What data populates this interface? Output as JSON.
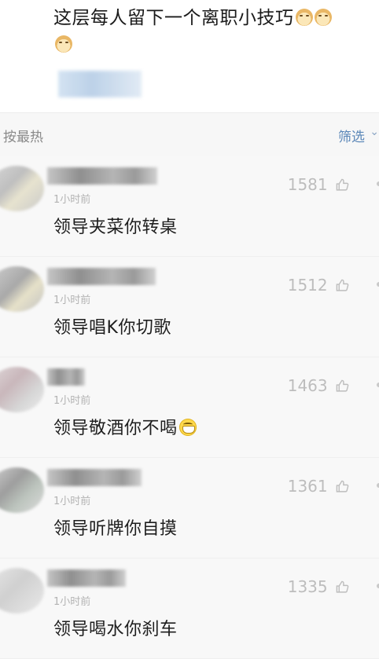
{
  "post": {
    "text": "这层每人留下一个离职小技巧",
    "emoji_inline_count": 2,
    "emoji_icon": "doge-emoji-icon"
  },
  "sort_bar": {
    "label": "按最热",
    "filter_label": "筛选",
    "filter_icon": "chevron-down-icon"
  },
  "comments": [
    {
      "time": "1小时前",
      "likes": "1581",
      "text": "领导夹菜你转桌",
      "emoji": ""
    },
    {
      "time": "1小时前",
      "likes": "1512",
      "text": "领导唱K你切歌",
      "emoji": ""
    },
    {
      "time": "1小时前",
      "likes": "1463",
      "text": "领导敬酒你不喝",
      "emoji": "grinning-face-icon"
    },
    {
      "time": "1小时前",
      "likes": "1361",
      "text": "领导听牌你自摸",
      "emoji": ""
    },
    {
      "time": "1小时前",
      "likes": "1335",
      "text": "领导喝水你刹车",
      "emoji": ""
    }
  ],
  "colors": {
    "accent": "#5b87b8",
    "muted": "#bdbdbd",
    "comment_bg": "#f8f8f8"
  }
}
